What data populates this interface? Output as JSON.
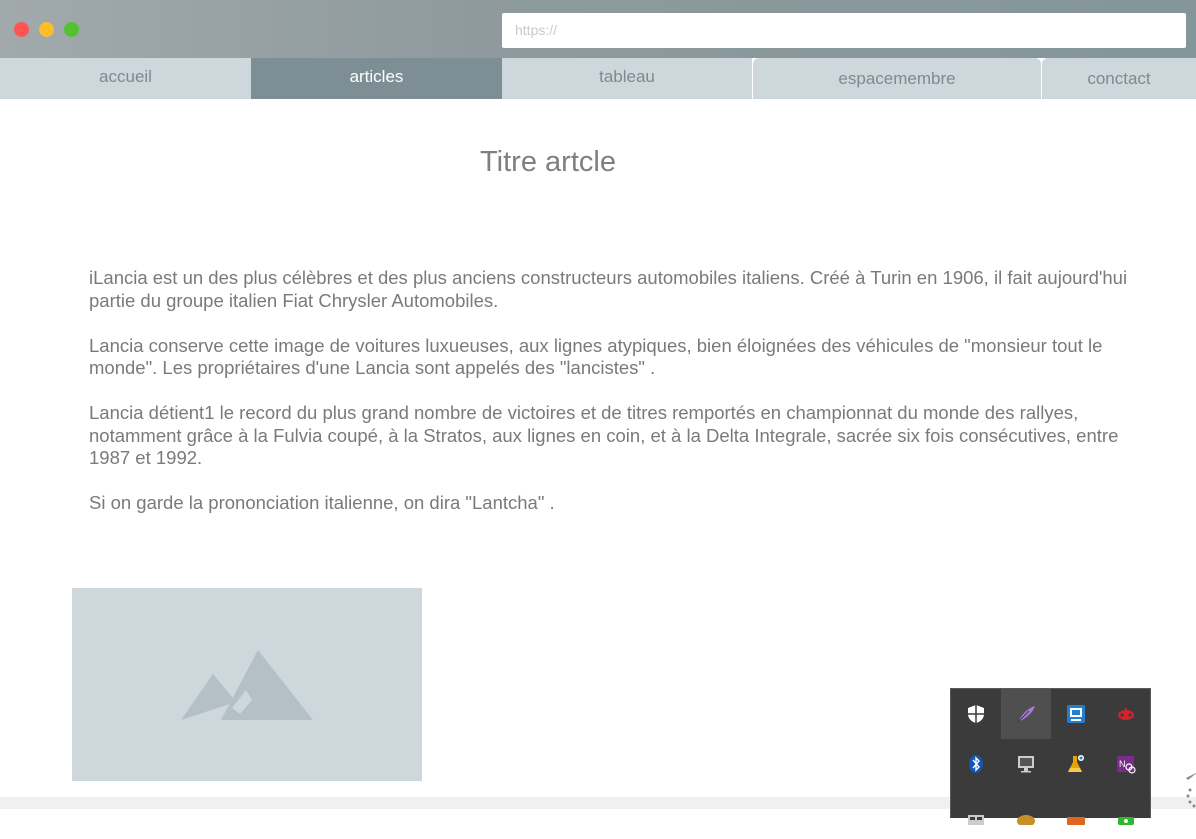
{
  "browser": {
    "url_placeholder": "https://"
  },
  "nav": {
    "tabs": [
      {
        "label": "accueil",
        "active": false
      },
      {
        "label": "articles",
        "active": true
      },
      {
        "label": "tableau",
        "active": false
      },
      {
        "label": "espacemembre",
        "active": false
      },
      {
        "label": "conctact",
        "active": false
      }
    ]
  },
  "article": {
    "title": "Titre artcle",
    "paragraphs": [
      "iLancia est un des plus célèbres et des plus anciens constructeurs automobiles italiens. Créé à Turin en 1906, il fait aujourd'hui partie du groupe italien Fiat Chrysler Automobiles.",
      "Lancia conserve cette image de voitures luxueuses, aux lignes atypiques, bien éloignées des véhicules de \"monsieur tout le monde\". Les propriétaires d'une Lancia sont appelés des \"lancistes\" .",
      "Lancia détient1 le record du plus grand nombre de victoires et de titres remportés en championnat du monde des rallyes, notamment grâce à la Fulvia coupé, à la Stratos, aux lignes en coin, et à la Delta Integrale, sacrée six fois consécutives, entre 1987 et 1992.",
      "Si on garde la prononciation italienne, on dira \"Lantcha\" ."
    ],
    "image_placeholder_icon": "mountain-image-icon"
  },
  "tray": {
    "icons": [
      "security-shield-icon",
      "feather-icon",
      "network-app-icon",
      "red-game-icon",
      "bluetooth-icon",
      "monitor-icon",
      "flask-icon",
      "onenote-icon",
      "grid-app-icon",
      "coin-icon",
      "orange-app-icon",
      "green-app-icon"
    ]
  },
  "colors": {
    "nav_inactive": "#ced7dc",
    "nav_active": "#7d8e94",
    "text": "#7a7a7a",
    "tray_bg": "#3b3b3b"
  }
}
